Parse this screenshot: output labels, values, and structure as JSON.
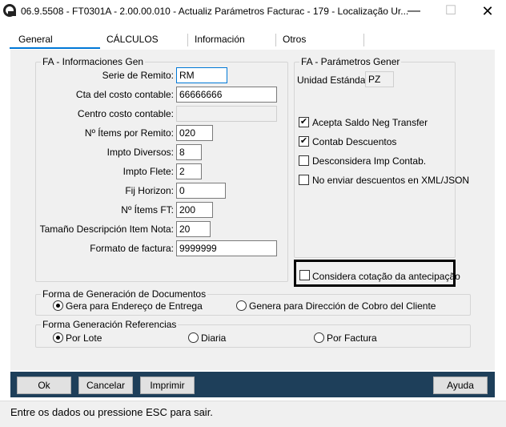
{
  "window": {
    "title": "06.9.5508 - FT0301A - 2.00.00.010 - Actualiz Parámetros Facturac - 179 - Localização Ur...",
    "minimize": "—",
    "maximize": "☐",
    "close": "✕"
  },
  "tabs": [
    "General",
    "CÁLCULOS",
    "Información",
    "Otros"
  ],
  "group_left": {
    "legend": "FA - Informaciones Gen",
    "fields": [
      {
        "label": "Serie de Remito:",
        "value": "RM"
      },
      {
        "label": "Cta del costo contable:",
        "value": "66666666"
      },
      {
        "label": "Centro costo contable:",
        "value": ""
      },
      {
        "label": "Nº Ítems por Remito:",
        "value": "020"
      },
      {
        "label": "Impto Diversos:",
        "value": "8"
      },
      {
        "label": "Impto Flete:",
        "value": "2"
      },
      {
        "label": "Fij Horizon:",
        "value": "0"
      },
      {
        "label": "Nº Ítems FT:",
        "value": "200"
      },
      {
        "label": "Tamaño Descripción Item Nota:",
        "value": "20"
      },
      {
        "label": "Formato de factura:",
        "value": "9999999"
      }
    ]
  },
  "group_right": {
    "legend": "FA - Parámetros Gener",
    "unidad_label": "Unidad Estándar:",
    "unidad_value": "PZ",
    "checks": [
      {
        "label": "Acepta Saldo Neg Transfer",
        "checked": true
      },
      {
        "label": "Contab Descuentos",
        "checked": true
      },
      {
        "label": "Desconsidera Imp Contab.",
        "checked": false
      },
      {
        "label": "No enviar descuentos en XML/JSON",
        "checked": false
      }
    ],
    "highlight_check": {
      "label": "Considera cotação da antecipação",
      "checked": false
    }
  },
  "group_docs": {
    "legend": "Forma de Generación de Documentos",
    "options": [
      {
        "label": "Gera para Endereço de Entrega",
        "selected": true
      },
      {
        "label": "Genera para Dirección de Cobro del Cliente",
        "selected": false
      }
    ]
  },
  "group_refs": {
    "legend": "Forma Generación Referencias",
    "options": [
      {
        "label": "Por Lote",
        "selected": true
      },
      {
        "label": "Diaria",
        "selected": false
      },
      {
        "label": "Por Factura",
        "selected": false
      }
    ]
  },
  "buttons": {
    "ok": "Ok",
    "cancel": "Cancelar",
    "print": "Imprimir",
    "help": "Ayuda"
  },
  "status": "Entre os dados ou pressione ESC para sair.",
  "colors": {
    "accent": "#0078d7",
    "button_bar": "#1e3f5a"
  }
}
